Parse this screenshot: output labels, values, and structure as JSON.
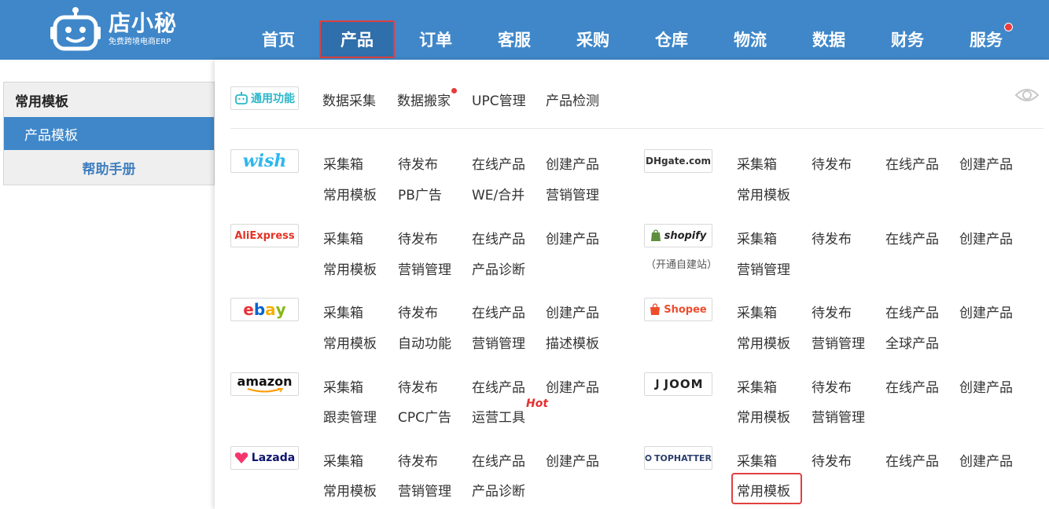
{
  "logo": {
    "name": "店小秘",
    "subtitle": "免费跨境电商ERP"
  },
  "nav": [
    {
      "label": "首页"
    },
    {
      "label": "产品",
      "active": true
    },
    {
      "label": "订单"
    },
    {
      "label": "客服"
    },
    {
      "label": "采购"
    },
    {
      "label": "仓库"
    },
    {
      "label": "物流"
    },
    {
      "label": "数据"
    },
    {
      "label": "财务"
    },
    {
      "label": "服务",
      "dot": true
    }
  ],
  "sidebar": {
    "title": "常用模板",
    "active": "产品模板",
    "help": "帮助手册"
  },
  "common": {
    "badge": "通用功能",
    "links": [
      "数据采集",
      "数据搬家",
      "UPC管理",
      "产品检测"
    ]
  },
  "platforms": {
    "wish": {
      "name": "wish",
      "links": [
        "采集箱",
        "待发布",
        "在线产品",
        "创建产品",
        "常用模板",
        "PB广告",
        "WE/合并",
        "营销管理"
      ]
    },
    "dhgate": {
      "name": "DHgate.com",
      "links": [
        "采集箱",
        "待发布",
        "在线产品",
        "创建产品",
        "常用模板"
      ]
    },
    "aliexpress": {
      "name": "AliExpress",
      "links": [
        "采集箱",
        "待发布",
        "在线产品",
        "创建产品",
        "常用模板",
        "营销管理",
        "产品诊断"
      ]
    },
    "shopify": {
      "name": "shopify",
      "note": "（开通自建站）",
      "links": [
        "采集箱",
        "待发布",
        "在线产品",
        "创建产品",
        "营销管理"
      ]
    },
    "ebay": {
      "name": "ebay",
      "links": [
        "采集箱",
        "待发布",
        "在线产品",
        "创建产品",
        "常用模板",
        "自动功能",
        "营销管理",
        "描述模板"
      ]
    },
    "shopee": {
      "name": "Shopee",
      "links": [
        "采集箱",
        "待发布",
        "在线产品",
        "创建产品",
        "常用模板",
        "营销管理",
        "全球产品"
      ]
    },
    "amazon": {
      "name": "amazon",
      "hot": "Hot",
      "links": [
        "采集箱",
        "待发布",
        "在线产品",
        "创建产品",
        "跟卖管理",
        "CPC广告",
        "运营工具"
      ]
    },
    "joom": {
      "name": "JOOM",
      "links": [
        "采集箱",
        "待发布",
        "在线产品",
        "创建产品",
        "常用模板",
        "营销管理"
      ]
    },
    "lazada": {
      "name": "Lazada",
      "links": [
        "采集箱",
        "待发布",
        "在线产品",
        "创建产品",
        "常用模板",
        "营销管理",
        "产品诊断"
      ]
    },
    "tophatter": {
      "name": "TOPHATTER",
      "links": [
        "采集箱",
        "待发布",
        "在线产品",
        "创建产品",
        "常用模板"
      ]
    }
  },
  "colors": {
    "header": "#3f87c9",
    "accent_red": "#e04040"
  }
}
